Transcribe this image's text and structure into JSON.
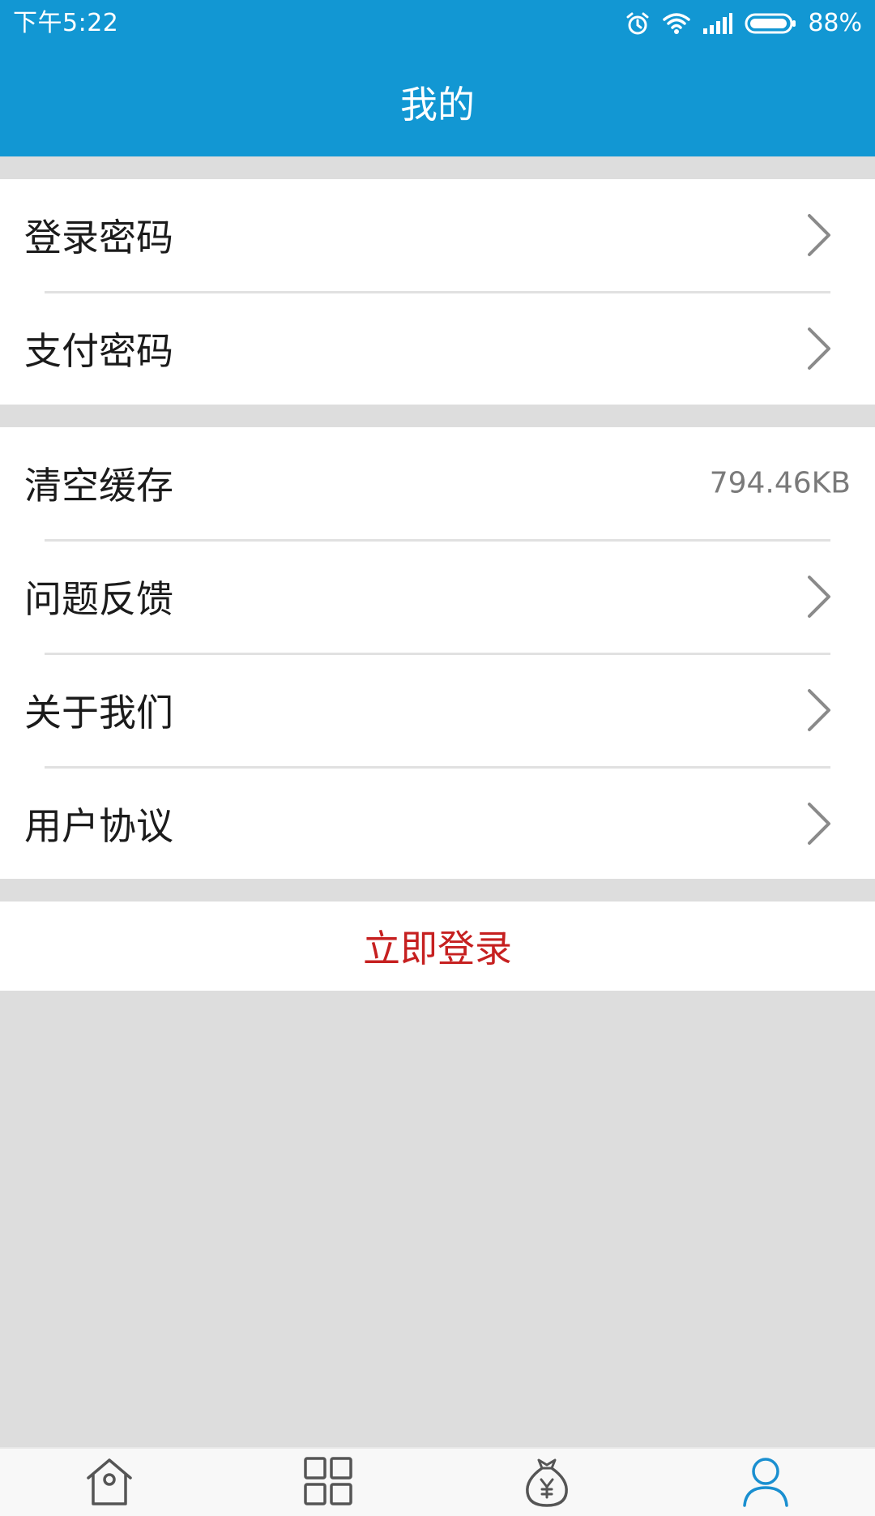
{
  "status_bar": {
    "time": "下午5:22",
    "battery": "88%",
    "icons": [
      "alarm-icon",
      "wifi-icon",
      "signal-icon",
      "battery-icon"
    ]
  },
  "header": {
    "title": "我的",
    "background_color": "#1297d3"
  },
  "security_group": {
    "items": [
      {
        "label": "登录密码",
        "icon": "chevron-right-icon"
      },
      {
        "label": "支付密码",
        "icon": "chevron-right-icon"
      }
    ]
  },
  "settings_group": {
    "items": [
      {
        "label": "清空缓存",
        "value": "794.46KB"
      },
      {
        "label": "问题反馈",
        "icon": "chevron-right-icon"
      },
      {
        "label": "关于我们",
        "icon": "chevron-right-icon"
      },
      {
        "label": "用户协议",
        "icon": "chevron-right-icon"
      }
    ]
  },
  "login": {
    "label": "立即登录",
    "color": "#c62020"
  },
  "bottom_nav": {
    "items": [
      {
        "icon": "home-icon",
        "active": false
      },
      {
        "icon": "grid-icon",
        "active": false
      },
      {
        "icon": "money-bag-icon",
        "active": false
      },
      {
        "icon": "user-icon",
        "active": true
      }
    ],
    "active_color": "#1a8fd0",
    "inactive_color": "#555555"
  }
}
